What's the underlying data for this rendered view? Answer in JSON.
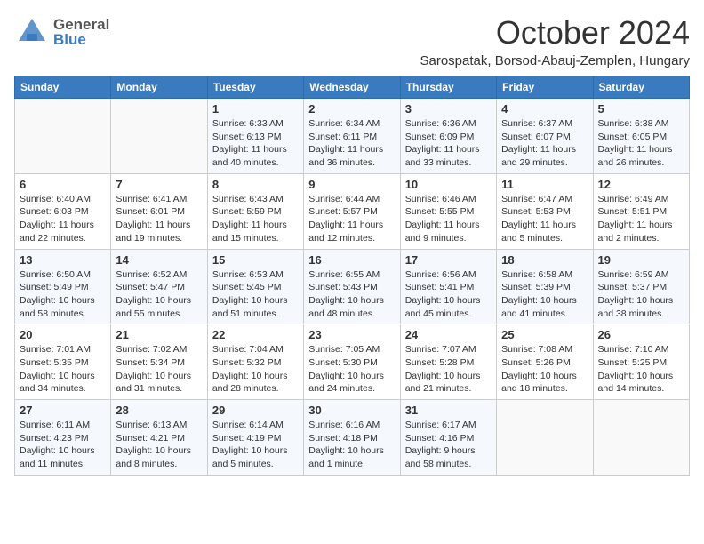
{
  "header": {
    "logo_general": "General",
    "logo_blue": "Blue",
    "month_title": "October 2024",
    "location": "Sarospatak, Borsod-Abauj-Zemplen, Hungary"
  },
  "calendar": {
    "weekdays": [
      "Sunday",
      "Monday",
      "Tuesday",
      "Wednesday",
      "Thursday",
      "Friday",
      "Saturday"
    ],
    "weeks": [
      [
        {
          "day": "",
          "info": ""
        },
        {
          "day": "",
          "info": ""
        },
        {
          "day": "1",
          "info": "Sunrise: 6:33 AM\nSunset: 6:13 PM\nDaylight: 11 hours and 40 minutes."
        },
        {
          "day": "2",
          "info": "Sunrise: 6:34 AM\nSunset: 6:11 PM\nDaylight: 11 hours and 36 minutes."
        },
        {
          "day": "3",
          "info": "Sunrise: 6:36 AM\nSunset: 6:09 PM\nDaylight: 11 hours and 33 minutes."
        },
        {
          "day": "4",
          "info": "Sunrise: 6:37 AM\nSunset: 6:07 PM\nDaylight: 11 hours and 29 minutes."
        },
        {
          "day": "5",
          "info": "Sunrise: 6:38 AM\nSunset: 6:05 PM\nDaylight: 11 hours and 26 minutes."
        }
      ],
      [
        {
          "day": "6",
          "info": "Sunrise: 6:40 AM\nSunset: 6:03 PM\nDaylight: 11 hours and 22 minutes."
        },
        {
          "day": "7",
          "info": "Sunrise: 6:41 AM\nSunset: 6:01 PM\nDaylight: 11 hours and 19 minutes."
        },
        {
          "day": "8",
          "info": "Sunrise: 6:43 AM\nSunset: 5:59 PM\nDaylight: 11 hours and 15 minutes."
        },
        {
          "day": "9",
          "info": "Sunrise: 6:44 AM\nSunset: 5:57 PM\nDaylight: 11 hours and 12 minutes."
        },
        {
          "day": "10",
          "info": "Sunrise: 6:46 AM\nSunset: 5:55 PM\nDaylight: 11 hours and 9 minutes."
        },
        {
          "day": "11",
          "info": "Sunrise: 6:47 AM\nSunset: 5:53 PM\nDaylight: 11 hours and 5 minutes."
        },
        {
          "day": "12",
          "info": "Sunrise: 6:49 AM\nSunset: 5:51 PM\nDaylight: 11 hours and 2 minutes."
        }
      ],
      [
        {
          "day": "13",
          "info": "Sunrise: 6:50 AM\nSunset: 5:49 PM\nDaylight: 10 hours and 58 minutes."
        },
        {
          "day": "14",
          "info": "Sunrise: 6:52 AM\nSunset: 5:47 PM\nDaylight: 10 hours and 55 minutes."
        },
        {
          "day": "15",
          "info": "Sunrise: 6:53 AM\nSunset: 5:45 PM\nDaylight: 10 hours and 51 minutes."
        },
        {
          "day": "16",
          "info": "Sunrise: 6:55 AM\nSunset: 5:43 PM\nDaylight: 10 hours and 48 minutes."
        },
        {
          "day": "17",
          "info": "Sunrise: 6:56 AM\nSunset: 5:41 PM\nDaylight: 10 hours and 45 minutes."
        },
        {
          "day": "18",
          "info": "Sunrise: 6:58 AM\nSunset: 5:39 PM\nDaylight: 10 hours and 41 minutes."
        },
        {
          "day": "19",
          "info": "Sunrise: 6:59 AM\nSunset: 5:37 PM\nDaylight: 10 hours and 38 minutes."
        }
      ],
      [
        {
          "day": "20",
          "info": "Sunrise: 7:01 AM\nSunset: 5:35 PM\nDaylight: 10 hours and 34 minutes."
        },
        {
          "day": "21",
          "info": "Sunrise: 7:02 AM\nSunset: 5:34 PM\nDaylight: 10 hours and 31 minutes."
        },
        {
          "day": "22",
          "info": "Sunrise: 7:04 AM\nSunset: 5:32 PM\nDaylight: 10 hours and 28 minutes."
        },
        {
          "day": "23",
          "info": "Sunrise: 7:05 AM\nSunset: 5:30 PM\nDaylight: 10 hours and 24 minutes."
        },
        {
          "day": "24",
          "info": "Sunrise: 7:07 AM\nSunset: 5:28 PM\nDaylight: 10 hours and 21 minutes."
        },
        {
          "day": "25",
          "info": "Sunrise: 7:08 AM\nSunset: 5:26 PM\nDaylight: 10 hours and 18 minutes."
        },
        {
          "day": "26",
          "info": "Sunrise: 7:10 AM\nSunset: 5:25 PM\nDaylight: 10 hours and 14 minutes."
        }
      ],
      [
        {
          "day": "27",
          "info": "Sunrise: 6:11 AM\nSunset: 4:23 PM\nDaylight: 10 hours and 11 minutes."
        },
        {
          "day": "28",
          "info": "Sunrise: 6:13 AM\nSunset: 4:21 PM\nDaylight: 10 hours and 8 minutes."
        },
        {
          "day": "29",
          "info": "Sunrise: 6:14 AM\nSunset: 4:19 PM\nDaylight: 10 hours and 5 minutes."
        },
        {
          "day": "30",
          "info": "Sunrise: 6:16 AM\nSunset: 4:18 PM\nDaylight: 10 hours and 1 minute."
        },
        {
          "day": "31",
          "info": "Sunrise: 6:17 AM\nSunset: 4:16 PM\nDaylight: 9 hours and 58 minutes."
        },
        {
          "day": "",
          "info": ""
        },
        {
          "day": "",
          "info": ""
        }
      ]
    ]
  }
}
